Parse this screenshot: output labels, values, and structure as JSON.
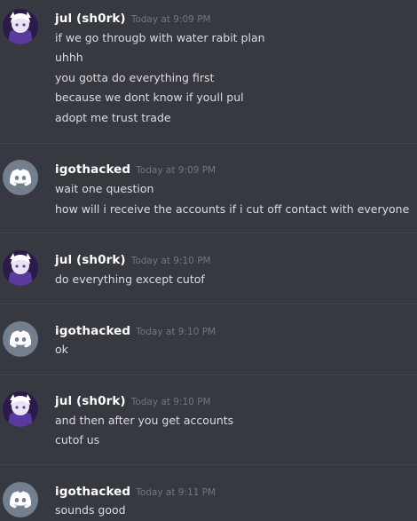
{
  "messages": [
    {
      "author": "jul (sh0rk)",
      "timestamp": "Today at 9:09 PM",
      "avatar": "anime-character-avatar",
      "lines": [
        "if we go througb with water rabit plan",
        "uhhh",
        "you gotta do everything first",
        "because we dont know if youll pul",
        "adopt me trust trade"
      ]
    },
    {
      "author": "igothacked",
      "timestamp": "Today at 9:09 PM",
      "avatar": "discord-default-avatar",
      "lines": [
        "wait one question",
        "how will i receive the accounts if i cut off contact with everyone"
      ]
    },
    {
      "author": "jul (sh0rk)",
      "timestamp": "Today at 9:10 PM",
      "avatar": "anime-character-avatar",
      "lines": [
        "do everything except cutof"
      ]
    },
    {
      "author": "igothacked",
      "timestamp": "Today at 9:10 PM",
      "avatar": "discord-default-avatar",
      "lines": [
        "ok"
      ]
    },
    {
      "author": "jul (sh0rk)",
      "timestamp": "Today at 9:10 PM",
      "avatar": "anime-character-avatar",
      "lines": [
        "and then after you get accounts",
        "cutof us"
      ]
    },
    {
      "author": "igothacked",
      "timestamp": "Today at 9:11 PM",
      "avatar": "discord-default-avatar",
      "lines": [
        "sounds good"
      ]
    }
  ],
  "colors": {
    "background": "#36393f",
    "divider": "#40434a",
    "username": "#ffffff",
    "timestamp": "#72767d",
    "message_text": "#dcddde",
    "discord_avatar_bg": "#747f8d"
  }
}
